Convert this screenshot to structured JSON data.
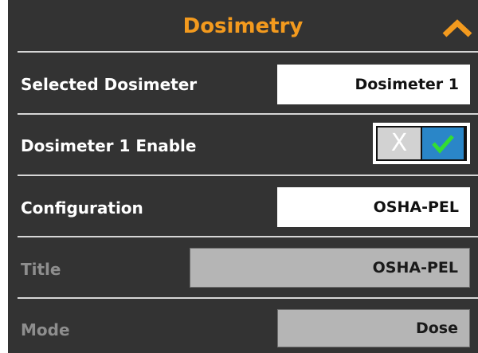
{
  "header": {
    "title": "Dosimetry",
    "collapse_icon": "chevron-up-icon",
    "accent_color": "#f39a1e"
  },
  "rows": {
    "selected_dosimeter": {
      "label": "Selected Dosimeter",
      "value": "Dosimeter 1"
    },
    "enable": {
      "label": "Dosimeter 1 Enable",
      "off_glyph": "X",
      "state": "on",
      "on_color": "#2a86c8",
      "check_color": "#33dd33"
    },
    "configuration": {
      "label": "Configuration",
      "value": "OSHA-PEL"
    },
    "title": {
      "label": "Title",
      "value": "OSHA-PEL"
    },
    "mode": {
      "label": "Mode",
      "value": "Dose"
    }
  }
}
